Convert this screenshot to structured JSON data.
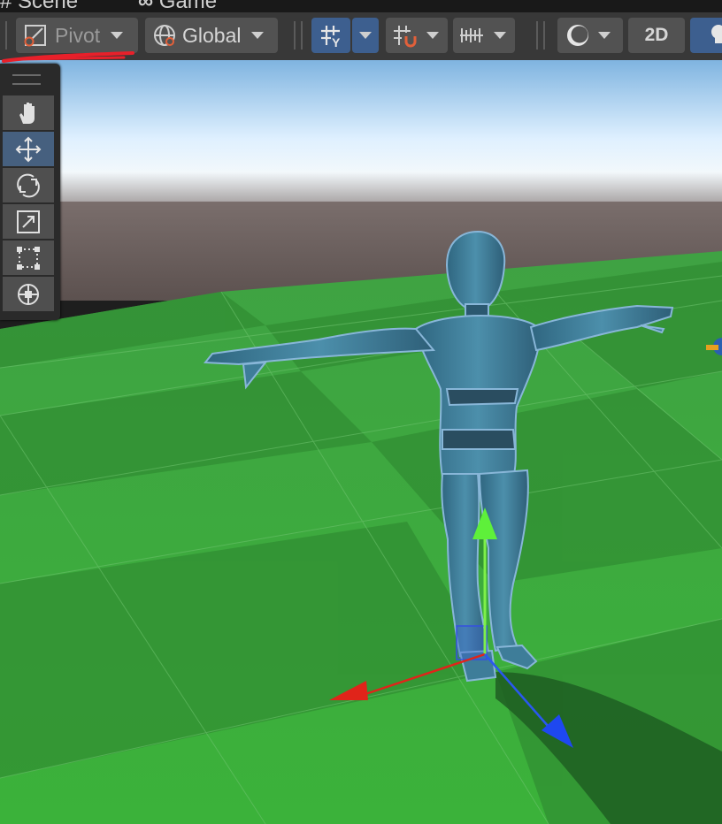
{
  "tabs": [
    {
      "label": "Scene",
      "icon": "hash-icon"
    },
    {
      "label": "Game",
      "icon": "gamepad-icon"
    }
  ],
  "toolbar": {
    "pivot_label": "Pivot",
    "global_label": "Global",
    "mode_2d_label": "2D"
  },
  "tools": [
    {
      "name": "hand-tool",
      "icon": "hand-icon"
    },
    {
      "name": "move-tool",
      "icon": "move-arrows-icon",
      "active": true
    },
    {
      "name": "rotate-tool",
      "icon": "rotate-icon"
    },
    {
      "name": "scale-tool",
      "icon": "scale-icon"
    },
    {
      "name": "rect-tool",
      "icon": "rect-transform-icon"
    },
    {
      "name": "transform-tool",
      "icon": "transform-icon"
    }
  ],
  "colors": {
    "toolbar_bg": "#383838",
    "button_bg": "#525252",
    "active_blue": "#3d5f8f",
    "ground_green": "#3cae3c",
    "character_blue": "#3e7d99",
    "gizmo_x": "#e0241a",
    "gizmo_y": "#5ef03a",
    "gizmo_z": "#1e48f0",
    "annotation_red": "#e8202a"
  }
}
